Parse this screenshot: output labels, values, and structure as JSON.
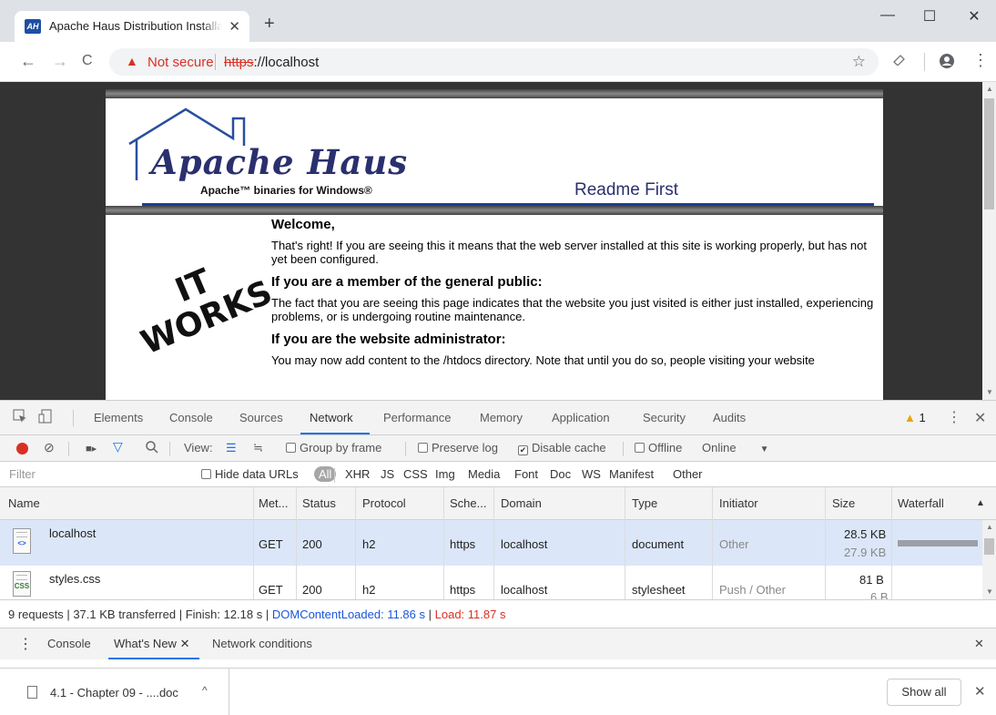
{
  "browser": {
    "tab_favicon": "AH",
    "tab_title": "Apache Haus Distribution Installation",
    "tab_close": "✕",
    "new_tab": "+",
    "window_controls": {
      "minimize": "—",
      "maximize": "☐",
      "close": "✕"
    },
    "nav": {
      "back": "←",
      "forward": "→",
      "reload": "C"
    },
    "security_warning": "Not secure",
    "url_scheme": "https",
    "url_rest": "://localhost",
    "icons": [
      "star-icon",
      "extension-icon",
      "profile-icon",
      "menu-icon"
    ]
  },
  "page": {
    "logo_main": "Apache Haus",
    "logo_tagline": "Apache™ binaries for Windows®",
    "readme": "Readme First",
    "it_works_line1": "IT",
    "it_works_line2": "WORKS",
    "welcome": "Welcome,",
    "p1": "That's right! If you are seeing this it means that the web server installed at this site is working properly, but has not yet been configured.",
    "h_public": "If you are a member of the general public:",
    "p2": "The fact that you are seeing this page indicates that the website you just visited is either just installed, experiencing problems, or is undergoing routine maintenance.",
    "h_admin": "If you are the website administrator:",
    "p3": "You may now add content to the /htdocs directory. Note that until you do so, people visiting your website"
  },
  "devtools": {
    "tabs": [
      "Elements",
      "Console",
      "Sources",
      "Network",
      "Performance",
      "Memory",
      "Application",
      "Security",
      "Audits"
    ],
    "active_tab": "Network",
    "warnings": "1",
    "network_toolbar": {
      "view_label": "View:",
      "group_by_frame": "Group by frame",
      "preserve_log": "Preserve log",
      "disable_cache": "Disable cache",
      "offline": "Offline",
      "throttle": "Online"
    },
    "filter": {
      "placeholder": "Filter",
      "hide_data_urls": "Hide data URLs",
      "types": [
        "All",
        "XHR",
        "JS",
        "CSS",
        "Img",
        "Media",
        "Font",
        "Doc",
        "WS",
        "Manifest",
        "Other"
      ]
    },
    "columns": [
      "Name",
      "Met...",
      "Status",
      "Protocol",
      "Sche...",
      "Domain",
      "Type",
      "Initiator",
      "Size",
      "Waterfall"
    ],
    "rows": [
      {
        "icon": "<>",
        "name": "localhost",
        "method": "GET",
        "status": "200",
        "protocol": "h2",
        "scheme": "https",
        "domain": "localhost",
        "type": "document",
        "initiator": "Other",
        "size": "28.5 KB",
        "size_sub": "27.9 KB"
      },
      {
        "icon": "CSS",
        "name": "styles.css",
        "method": "GET",
        "status": "200",
        "protocol": "h2",
        "scheme": "https",
        "domain": "localhost",
        "type": "stylesheet",
        "initiator": "Push / Other",
        "size": "81 B",
        "size_sub": "6 B"
      }
    ],
    "summary": {
      "requests": "9 requests",
      "transferred": "37.1 KB transferred",
      "finish": "Finish: 12.18 s",
      "dom_loaded": "DOMContentLoaded: 11.86 s",
      "load": "Load: 11.87 s"
    },
    "drawer_tabs": [
      "Console",
      "What's New",
      "Network conditions"
    ]
  },
  "shelf": {
    "download_name": "4.1 - Chapter 09 - ....doc",
    "show_all": "Show all"
  }
}
